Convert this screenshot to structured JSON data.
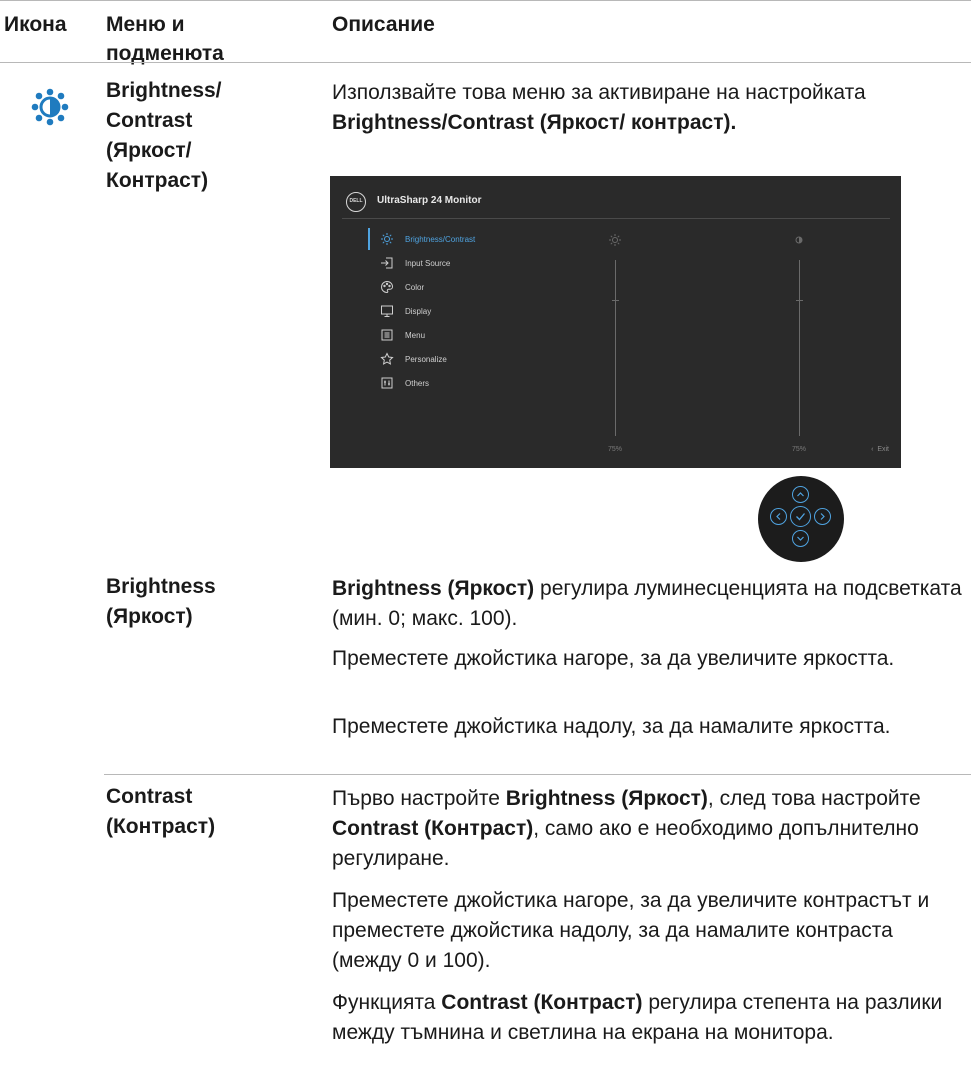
{
  "header": {
    "col_icon": "Икона",
    "col_menu": "Меню и подменюта",
    "col_desc": "Описание"
  },
  "row_main": {
    "name": "Brightness/ Contrast (Яркост/ Контраст)",
    "desc_prefix": "Използвайте това меню за активиране на настройката ",
    "desc_bold": "Brightness/Contrast (Яркост/ контраст).",
    "icon": "brightness-icon"
  },
  "osd": {
    "title": "UltraSharp 24 Monitor",
    "logo": "DELL",
    "menu": [
      {
        "label": "Brightness/Contrast",
        "icon": "sun-icon",
        "active": true
      },
      {
        "label": "Input Source",
        "icon": "input-icon",
        "active": false
      },
      {
        "label": "Color",
        "icon": "palette-icon",
        "active": false
      },
      {
        "label": "Display",
        "icon": "monitor-icon",
        "active": false
      },
      {
        "label": "Menu",
        "icon": "menu-icon",
        "active": false
      },
      {
        "label": "Personalize",
        "icon": "star-icon",
        "active": false
      },
      {
        "label": "Others",
        "icon": "others-icon",
        "active": false
      }
    ],
    "brightness_value": "75%",
    "contrast_value": "75%",
    "exit_label": "Exit",
    "colors": {
      "accent": "#4fa3e0",
      "panel": "#2a2a2a"
    }
  },
  "row_brightness": {
    "name": "Brightness (Яркост)",
    "p1_bold": "Brightness (Яркост)",
    "p1_rest": " регулира луминесценцията на подсветката (мин. 0; макс. 100).",
    "p2": "Преместете джойстика нагоре, за да увеличите яркостта.",
    "p3": "Преместете джойстика надолу, за да намалите яркостта."
  },
  "row_contrast": {
    "name": "Contrast (Контраст)",
    "p1_a": "Първо настройте ",
    "p1_b": "Brightness (Яркост)",
    "p1_c": ", след това настройте ",
    "p1_d": "Contrast (Контраст)",
    "p1_e": ", само ако е необходимо допълнително регулиране.",
    "p2": "Преместете джойстика нагоре, за да увеличите контрастът и преместете джойстика надолу, за да намалите контраста (между 0 и 100).",
    "p3_a": "Функцията ",
    "p3_b": "Contrast (Контраст)",
    "p3_c": " регулира степента на разлики между тъмнина и светлина на екрана на монитора."
  }
}
